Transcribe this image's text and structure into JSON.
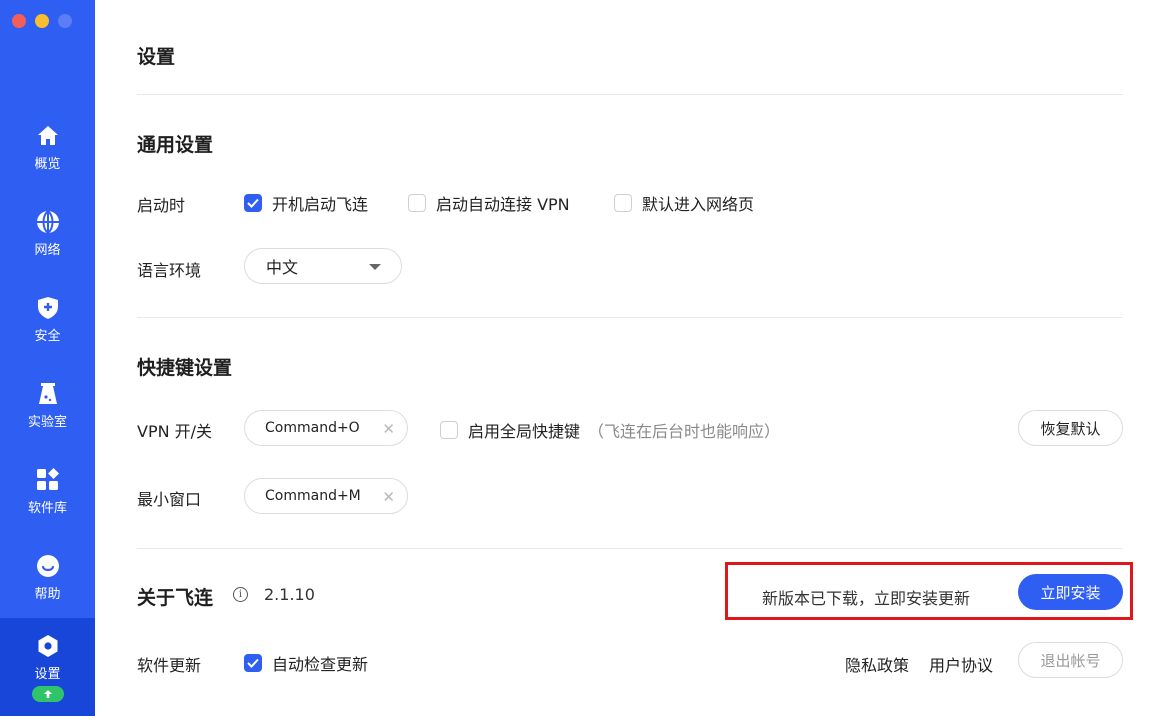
{
  "sidebar": {
    "items": [
      {
        "label": "概览",
        "icon": "home-icon"
      },
      {
        "label": "网络",
        "icon": "globe-icon"
      },
      {
        "label": "安全",
        "icon": "shield-icon"
      },
      {
        "label": "实验室",
        "icon": "flask-icon"
      },
      {
        "label": "软件库",
        "icon": "apps-icon"
      },
      {
        "label": "帮助",
        "icon": "help-icon"
      },
      {
        "label": "设置",
        "icon": "settings-icon"
      }
    ],
    "accent": "#2f5ff2",
    "update_badge": "update-arrow-icon"
  },
  "page": {
    "title": "设置"
  },
  "general": {
    "title": "通用设置",
    "startup_label": "启动时",
    "startup_options": [
      {
        "label": "开机启动飞连",
        "checked": true
      },
      {
        "label": "启动自动连接 VPN",
        "checked": false
      },
      {
        "label": "默认进入网络页",
        "checked": false
      }
    ],
    "language_label": "语言环境",
    "language_value": "中文"
  },
  "shortcuts": {
    "title": "快捷键设置",
    "vpn_label": "VPN 开/关",
    "vpn_value": "Command+O",
    "global_label": "启用全局快捷键",
    "global_hint": "（飞连在后台时也能响应）",
    "global_checked": false,
    "restore_label": "恢复默认",
    "minimize_label": "最小窗口",
    "minimize_value": "Command+M"
  },
  "about": {
    "title": "关于飞连",
    "version": "2.1.10",
    "update_message": "新版本已下载，立即安装更新",
    "install_label": "立即安装",
    "auto_update_label": "软件更新",
    "auto_update_option": "自动检查更新",
    "auto_update_checked": true,
    "privacy_label": "隐私政策",
    "agreement_label": "用户协议",
    "logout_label": "退出帐号"
  }
}
